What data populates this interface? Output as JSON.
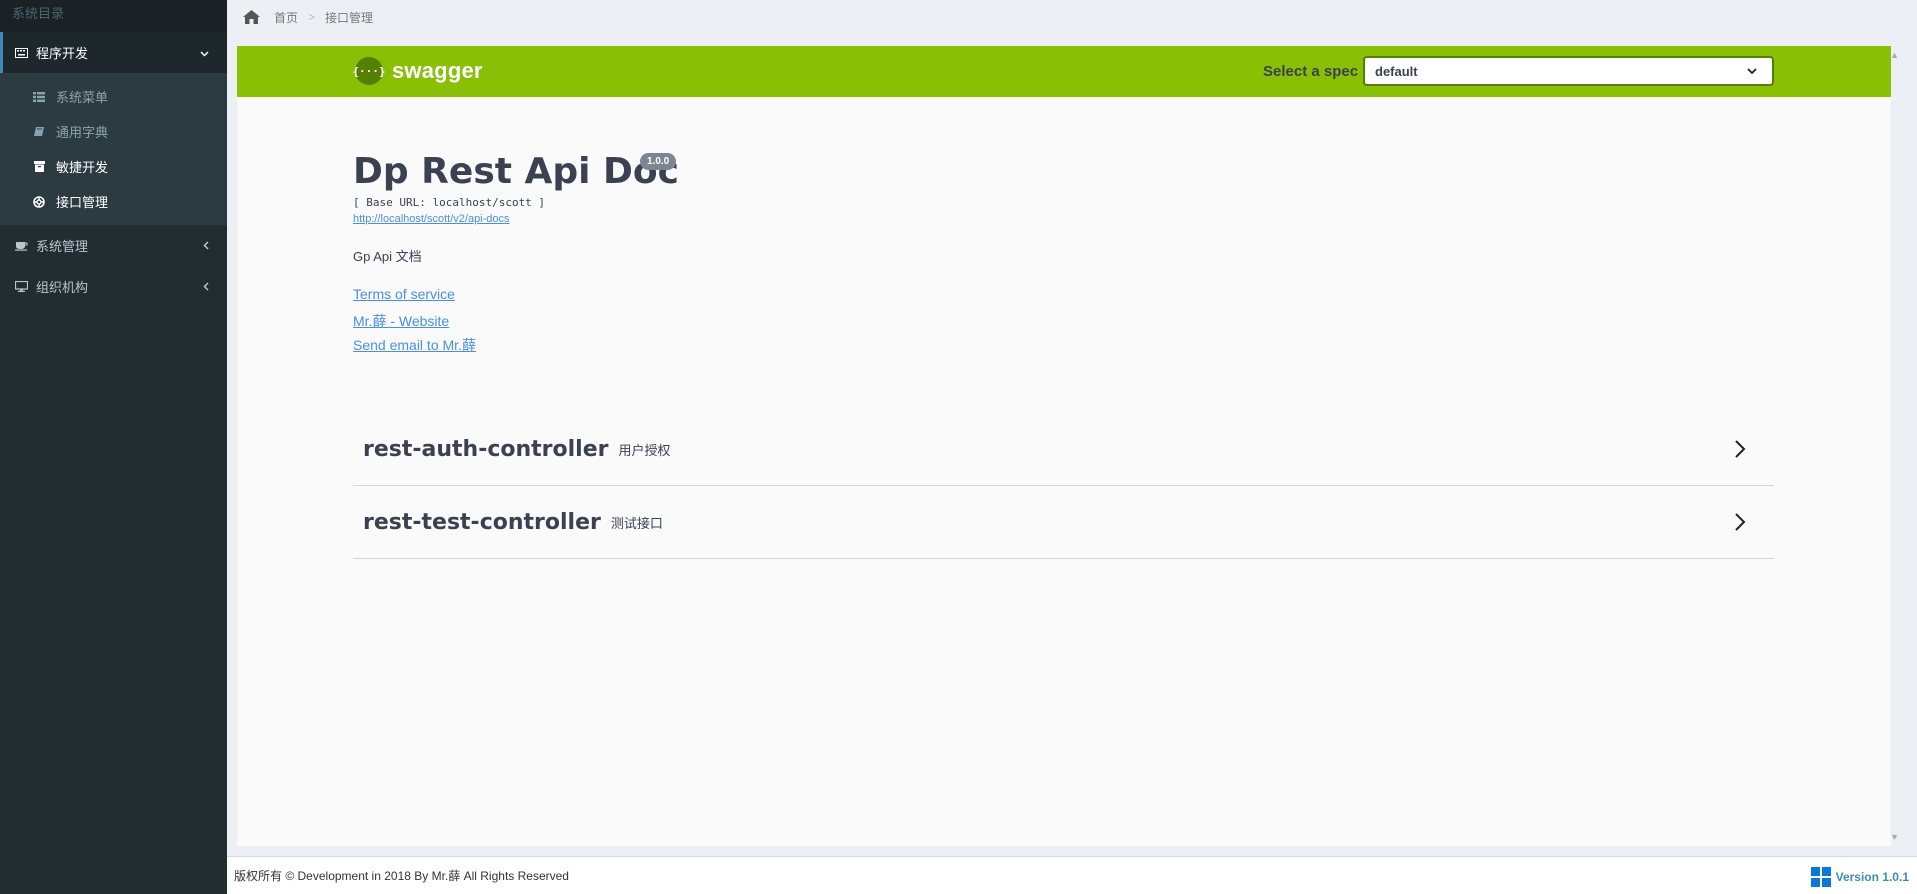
{
  "sidebar": {
    "header": "系统目录",
    "groups": [
      {
        "label": "程序开发",
        "open": true,
        "items": [
          {
            "label": "系统菜单",
            "icon": "list-icon"
          },
          {
            "label": "通用字典",
            "icon": "book-icon"
          },
          {
            "label": "敏捷开发",
            "icon": "box-icon"
          },
          {
            "label": "接口管理",
            "icon": "lifebuoy-icon"
          }
        ]
      },
      {
        "label": "系统管理",
        "open": false
      },
      {
        "label": "组织机构",
        "open": false
      }
    ]
  },
  "breadcrumb": {
    "home": "首页",
    "separator": ">",
    "current": "接口管理"
  },
  "swagger": {
    "logo_symbol": "{···}",
    "logo_text": "swagger",
    "spec_label": "Select a spec",
    "spec_value": "default",
    "accent": "#89bf04"
  },
  "info": {
    "title": "Dp Rest Api Doc",
    "version": "1.0.0",
    "base_url": "[ Base URL: localhost/scott ]",
    "api_docs_link": "http://localhost/scott/v2/api-docs",
    "description": "Gp Api 文档",
    "terms": "Terms of service",
    "website": "Mr.薛 - Website",
    "email": "Send email to Mr.薛"
  },
  "tags": [
    {
      "name": "rest-auth-controller",
      "desc": "用户授权"
    },
    {
      "name": "rest-test-controller",
      "desc": "测试接口"
    }
  ],
  "footer": {
    "copyright": "版权所有 © Development in 2018 By Mr.薛 All Rights Reserved",
    "version": "Version 1.0.1"
  }
}
